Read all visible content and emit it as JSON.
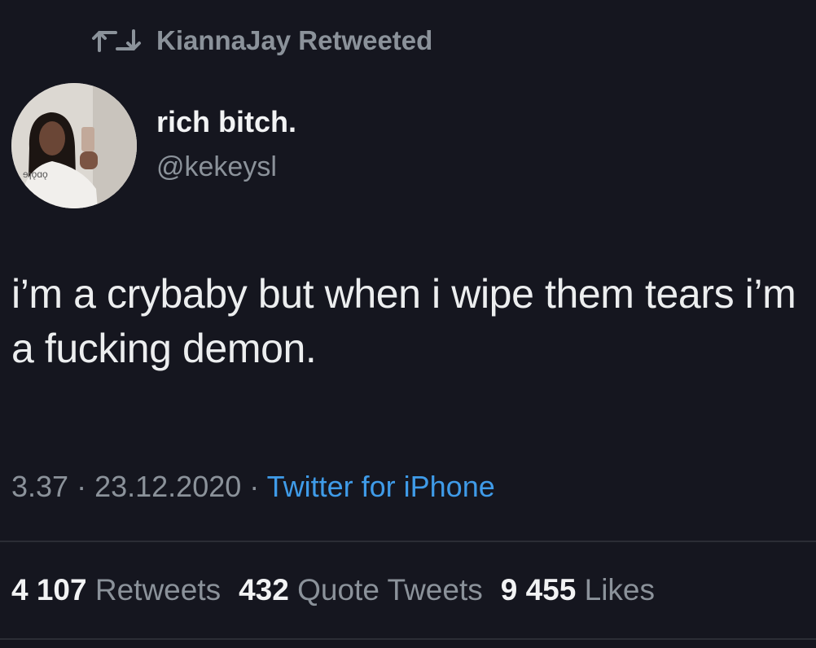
{
  "retweet_banner": {
    "icon": "retweet-icon",
    "text": "KiannaJay Retweeted"
  },
  "author": {
    "display_name": "rich bitch.",
    "handle": "@kekeysl",
    "avatar_icon": "avatar"
  },
  "tweet": {
    "text": "i’m a crybaby but when i wipe them tears i’m a fucking demon."
  },
  "meta": {
    "time": "3.37",
    "separator1": " · ",
    "date": "23.12.2020",
    "separator2": " · ",
    "source": "Twitter for iPhone"
  },
  "stats": [
    {
      "count": "4 107",
      "label": "Retweets"
    },
    {
      "count": "432",
      "label": "Quote Tweets"
    },
    {
      "count": "9 455",
      "label": "Likes"
    }
  ],
  "colors": {
    "background": "#15161f",
    "primary_text": "#eceeef",
    "secondary_text": "#8b929a",
    "link": "#3f9be8",
    "divider": "#2b2d35"
  }
}
